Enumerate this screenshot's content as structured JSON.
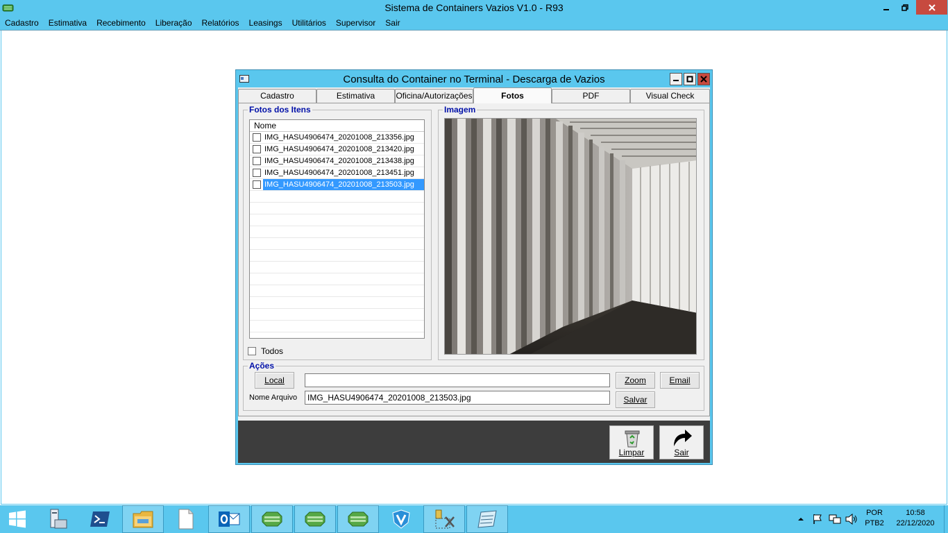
{
  "app": {
    "title": "Sistema de Containers Vazios V1.0 - R93"
  },
  "menu": [
    "Cadastro",
    "Estimativa",
    "Recebimento",
    "Liberação",
    "Relatórios",
    "Leasings",
    "Utilitários",
    "Supervisor",
    "Sair"
  ],
  "dialog": {
    "title": "Consulta do Container no Terminal - Descarga de Vazios",
    "tabs": [
      "Cadastro",
      "Estimativa",
      "Oficina/Autorizações",
      "Fotos",
      "PDF",
      "Visual Check"
    ],
    "active_tab": "Fotos",
    "fotos_group": {
      "label": "Fotos dos Itens",
      "column_header": "Nome",
      "files": [
        "IMG_HASU4906474_20201008_213356.jpg",
        "IMG_HASU4906474_20201008_213420.jpg",
        "IMG_HASU4906474_20201008_213438.jpg",
        "IMG_HASU4906474_20201008_213451.jpg",
        "IMG_HASU4906474_20201008_213503.jpg"
      ],
      "selected_index": 4,
      "todos_label": "Todos"
    },
    "imagem_group": {
      "label": "Imagem"
    },
    "acoes_group": {
      "label": "Ações",
      "local_button": "Local",
      "path_value": "",
      "zoom_button": "Zoom",
      "email_button": "Email",
      "nome_arquivo_label": "Nome Arquivo",
      "nome_arquivo_value": "IMG_HASU4906474_20201008_213503.jpg",
      "salvar_button": "Salvar"
    },
    "footer": {
      "limpar_button": "Limpar",
      "sair_button": "Sair"
    }
  },
  "taskbar": {
    "language": "POR",
    "keyboard": "PTB2",
    "time": "10:58",
    "date": "22/12/2020"
  },
  "colors": {
    "accent": "#5ac7ee",
    "close": "#c74a3f",
    "group_label": "#0010a8",
    "selection": "#3399ff",
    "footer": "#3d3d3d"
  }
}
